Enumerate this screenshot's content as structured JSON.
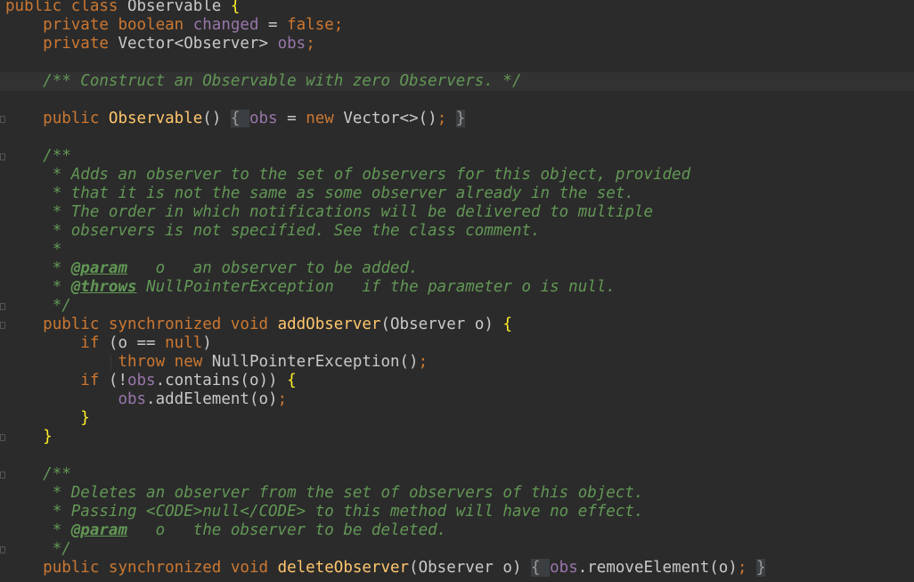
{
  "editor": {
    "lines": [
      {
        "segments": [
          {
            "c": "kw",
            "t": "public class "
          },
          {
            "c": "pl",
            "t": "Observable "
          },
          {
            "c": "br",
            "t": "{"
          }
        ]
      },
      {
        "segments": [
          {
            "c": "pl",
            "t": "    "
          },
          {
            "c": "kw",
            "t": "private boolean "
          },
          {
            "c": "fld",
            "t": "changed"
          },
          {
            "c": "pl",
            "t": " = "
          },
          {
            "c": "kw",
            "t": "false"
          },
          {
            "c": "kw",
            "t": ";"
          }
        ]
      },
      {
        "segments": [
          {
            "c": "pl",
            "t": "    "
          },
          {
            "c": "kw",
            "t": "private "
          },
          {
            "c": "pl",
            "t": "Vector<Observer> "
          },
          {
            "c": "fld",
            "t": "obs"
          },
          {
            "c": "kw",
            "t": ";"
          }
        ]
      },
      {
        "segments": []
      },
      {
        "segments": [
          {
            "c": "pl",
            "t": "    "
          },
          {
            "c": "cm",
            "t": "/** Construct an Observable with zero Observers. */"
          }
        ]
      },
      {
        "segments": []
      },
      {
        "segments": [
          {
            "c": "pl",
            "t": "    "
          },
          {
            "c": "kw",
            "t": "public "
          },
          {
            "c": "fn",
            "t": "Observable"
          },
          {
            "c": "pl",
            "t": "() "
          },
          {
            "c": "fold",
            "t": "{ "
          },
          {
            "c": "fld",
            "t": "obs"
          },
          {
            "c": "pl",
            "t": " = "
          },
          {
            "c": "kw",
            "t": "new "
          },
          {
            "c": "pl",
            "t": "Vector<>()"
          },
          {
            "c": "kw",
            "t": "; "
          },
          {
            "c": "fold",
            "t": "}"
          }
        ]
      },
      {
        "segments": []
      },
      {
        "segments": [
          {
            "c": "pl",
            "t": "    "
          },
          {
            "c": "cm",
            "t": "/**"
          }
        ]
      },
      {
        "segments": [
          {
            "c": "pl",
            "t": "     "
          },
          {
            "c": "cm",
            "t": "* Adds an observer to the set of observers for this object, provided"
          }
        ]
      },
      {
        "segments": [
          {
            "c": "pl",
            "t": "     "
          },
          {
            "c": "cm",
            "t": "* that it is not the same as some observer already in the set."
          }
        ]
      },
      {
        "segments": [
          {
            "c": "pl",
            "t": "     "
          },
          {
            "c": "cm",
            "t": "* The order in which notifications will be delivered to multiple"
          }
        ]
      },
      {
        "segments": [
          {
            "c": "pl",
            "t": "     "
          },
          {
            "c": "cm",
            "t": "* observers is not specified. See the class comment."
          }
        ]
      },
      {
        "segments": [
          {
            "c": "pl",
            "t": "     "
          },
          {
            "c": "cm",
            "t": "*"
          }
        ]
      },
      {
        "segments": [
          {
            "c": "pl",
            "t": "     "
          },
          {
            "c": "cm",
            "t": "* "
          },
          {
            "c": "tag",
            "t": "@param"
          },
          {
            "c": "cm",
            "t": "   o   an observer to be added."
          }
        ]
      },
      {
        "segments": [
          {
            "c": "pl",
            "t": "     "
          },
          {
            "c": "cm",
            "t": "* "
          },
          {
            "c": "tag",
            "t": "@throws"
          },
          {
            "c": "cm",
            "t": " NullPointerException   if the parameter o is null."
          }
        ]
      },
      {
        "segments": [
          {
            "c": "pl",
            "t": "     "
          },
          {
            "c": "cm",
            "t": "*/"
          }
        ]
      },
      {
        "segments": [
          {
            "c": "pl",
            "t": "    "
          },
          {
            "c": "kw",
            "t": "public synchronized void "
          },
          {
            "c": "fn",
            "t": "addObserver"
          },
          {
            "c": "pl",
            "t": "(Observer o) "
          },
          {
            "c": "br",
            "t": "{"
          }
        ]
      },
      {
        "segments": [
          {
            "c": "pl",
            "t": "        "
          },
          {
            "c": "kw",
            "t": "if "
          },
          {
            "c": "pl",
            "t": "(o == "
          },
          {
            "c": "kw",
            "t": "null"
          },
          {
            "c": "pl",
            "t": ")"
          }
        ]
      },
      {
        "segments": [
          {
            "c": "pl",
            "t": "            "
          },
          {
            "c": "kw",
            "t": "throw new "
          },
          {
            "c": "pl",
            "t": "NullPointerException()"
          },
          {
            "c": "kw",
            "t": ";"
          }
        ]
      },
      {
        "segments": [
          {
            "c": "pl",
            "t": "        "
          },
          {
            "c": "kw",
            "t": "if "
          },
          {
            "c": "pl",
            "t": "(!"
          },
          {
            "c": "fld",
            "t": "obs"
          },
          {
            "c": "pl",
            "t": ".contains(o)) "
          },
          {
            "c": "br",
            "t": "{"
          }
        ]
      },
      {
        "segments": [
          {
            "c": "pl",
            "t": "            "
          },
          {
            "c": "fld",
            "t": "obs"
          },
          {
            "c": "pl",
            "t": ".addElement(o)"
          },
          {
            "c": "kw",
            "t": ";"
          }
        ]
      },
      {
        "segments": [
          {
            "c": "pl",
            "t": "        "
          },
          {
            "c": "br",
            "t": "}"
          }
        ]
      },
      {
        "segments": [
          {
            "c": "pl",
            "t": "    "
          },
          {
            "c": "br",
            "t": "}"
          }
        ]
      },
      {
        "segments": []
      },
      {
        "segments": [
          {
            "c": "pl",
            "t": "    "
          },
          {
            "c": "cm",
            "t": "/**"
          }
        ]
      },
      {
        "segments": [
          {
            "c": "pl",
            "t": "     "
          },
          {
            "c": "cm",
            "t": "* Deletes an observer from the set of observers of this object."
          }
        ]
      },
      {
        "segments": [
          {
            "c": "pl",
            "t": "     "
          },
          {
            "c": "cm",
            "t": "* Passing <CODE>null</CODE> to this method will have no effect."
          }
        ]
      },
      {
        "segments": [
          {
            "c": "pl",
            "t": "     "
          },
          {
            "c": "cm",
            "t": "* "
          },
          {
            "c": "tag",
            "t": "@param"
          },
          {
            "c": "cm",
            "t": "   o   the observer to be deleted."
          }
        ]
      },
      {
        "segments": [
          {
            "c": "pl",
            "t": "     "
          },
          {
            "c": "cm",
            "t": "*/"
          }
        ]
      },
      {
        "segments": [
          {
            "c": "pl",
            "t": "    "
          },
          {
            "c": "kw",
            "t": "public synchronized void "
          },
          {
            "c": "fn",
            "t": "deleteObserver"
          },
          {
            "c": "pl",
            "t": "(Observer o) "
          },
          {
            "c": "fold",
            "t": "{ "
          },
          {
            "c": "fld",
            "t": "obs"
          },
          {
            "c": "pl",
            "t": ".removeElement(o)"
          },
          {
            "c": "kw",
            "t": "; "
          },
          {
            "c": "fold",
            "t": "}"
          }
        ]
      }
    ]
  },
  "colors": {
    "background": "#2b2b2b",
    "keyword": "#cc7832",
    "field": "#9876aa",
    "method": "#ffc66d",
    "comment": "#629755",
    "plain": "#c9c9c9"
  }
}
